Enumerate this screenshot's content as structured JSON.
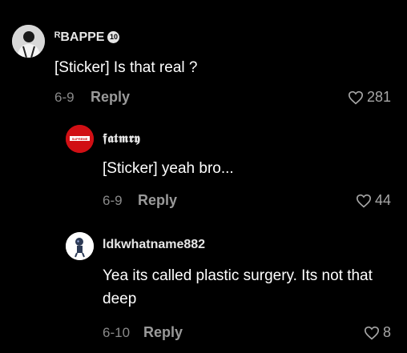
{
  "comments": [
    {
      "username": "ᴿBAPPE",
      "badge": "10",
      "text": "[Sticker] Is that real ?",
      "date": "6-9",
      "reply_label": "Reply",
      "likes": "281",
      "avatar_icon": "player-photo-avatar"
    },
    {
      "username": "𝖋𝖆𝖙𝖒𝖗𝖞",
      "text": "[Sticker] yeah bro...",
      "date": "6-9",
      "reply_label": "Reply",
      "likes": "44",
      "avatar_icon": "red-logo-avatar",
      "avatar_text": "SUPREME"
    },
    {
      "username": "ldkwhatname882",
      "text": "Yea its called plastic surgery. Its not that deep",
      "date": "6-10",
      "reply_label": "Reply",
      "likes": "8",
      "avatar_icon": "robot-avatar"
    }
  ],
  "colors": {
    "background": "#000000",
    "meta": "#8a8a8a",
    "avatar_red": "#d10f14"
  }
}
